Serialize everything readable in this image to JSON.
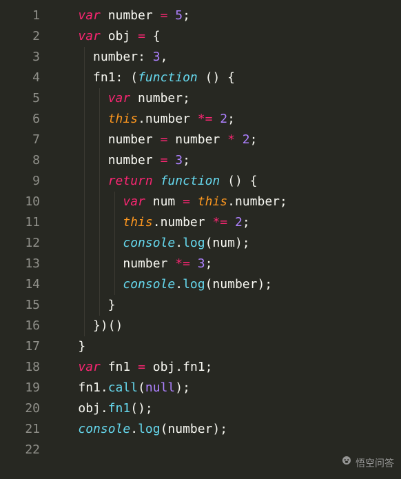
{
  "editor": {
    "line_count": 22,
    "line_numbers": [
      "1",
      "2",
      "3",
      "4",
      "5",
      "6",
      "7",
      "8",
      "9",
      "10",
      "11",
      "12",
      "13",
      "14",
      "15",
      "16",
      "17",
      "18",
      "19",
      "20",
      "21",
      "22"
    ],
    "indent_unit": "  ",
    "lines": [
      {
        "indent": 2,
        "tokens": [
          {
            "cls": "kw",
            "t": "var"
          },
          {
            "cls": "ident",
            "t": " number "
          },
          {
            "cls": "op",
            "t": "="
          },
          {
            "cls": "ident",
            "t": " "
          },
          {
            "cls": "num",
            "t": "5"
          },
          {
            "cls": "punc",
            "t": ";"
          }
        ]
      },
      {
        "indent": 2,
        "tokens": [
          {
            "cls": "kw",
            "t": "var"
          },
          {
            "cls": "ident",
            "t": " obj "
          },
          {
            "cls": "op",
            "t": "="
          },
          {
            "cls": "ident",
            "t": " "
          },
          {
            "cls": "punc",
            "t": "{"
          }
        ]
      },
      {
        "indent": 3,
        "tokens": [
          {
            "cls": "ident",
            "t": "number"
          },
          {
            "cls": "punc",
            "t": ": "
          },
          {
            "cls": "num",
            "t": "3"
          },
          {
            "cls": "punc",
            "t": ","
          }
        ]
      },
      {
        "indent": 3,
        "tokens": [
          {
            "cls": "ident",
            "t": "fn1"
          },
          {
            "cls": "punc",
            "t": ": ("
          },
          {
            "cls": "func",
            "t": "function"
          },
          {
            "cls": "punc",
            "t": " () {"
          }
        ]
      },
      {
        "indent": 4,
        "tokens": [
          {
            "cls": "kw",
            "t": "var"
          },
          {
            "cls": "ident",
            "t": " number"
          },
          {
            "cls": "punc",
            "t": ";"
          }
        ]
      },
      {
        "indent": 4,
        "tokens": [
          {
            "cls": "this",
            "t": "this"
          },
          {
            "cls": "punc",
            "t": "."
          },
          {
            "cls": "ident",
            "t": "number "
          },
          {
            "cls": "op",
            "t": "*="
          },
          {
            "cls": "ident",
            "t": " "
          },
          {
            "cls": "num",
            "t": "2"
          },
          {
            "cls": "punc",
            "t": ";"
          }
        ]
      },
      {
        "indent": 4,
        "tokens": [
          {
            "cls": "ident",
            "t": "number "
          },
          {
            "cls": "op",
            "t": "="
          },
          {
            "cls": "ident",
            "t": " number "
          },
          {
            "cls": "op",
            "t": "*"
          },
          {
            "cls": "ident",
            "t": " "
          },
          {
            "cls": "num",
            "t": "2"
          },
          {
            "cls": "punc",
            "t": ";"
          }
        ]
      },
      {
        "indent": 4,
        "tokens": [
          {
            "cls": "ident",
            "t": "number "
          },
          {
            "cls": "op",
            "t": "="
          },
          {
            "cls": "ident",
            "t": " "
          },
          {
            "cls": "num",
            "t": "3"
          },
          {
            "cls": "punc",
            "t": ";"
          }
        ]
      },
      {
        "indent": 4,
        "tokens": [
          {
            "cls": "kw",
            "t": "return"
          },
          {
            "cls": "ident",
            "t": " "
          },
          {
            "cls": "func",
            "t": "function"
          },
          {
            "cls": "punc",
            "t": " () {"
          }
        ]
      },
      {
        "indent": 5,
        "tokens": [
          {
            "cls": "kw",
            "t": "var"
          },
          {
            "cls": "ident",
            "t": " num "
          },
          {
            "cls": "op",
            "t": "="
          },
          {
            "cls": "ident",
            "t": " "
          },
          {
            "cls": "this",
            "t": "this"
          },
          {
            "cls": "punc",
            "t": "."
          },
          {
            "cls": "ident",
            "t": "number"
          },
          {
            "cls": "punc",
            "t": ";"
          }
        ]
      },
      {
        "indent": 5,
        "tokens": [
          {
            "cls": "this",
            "t": "this"
          },
          {
            "cls": "punc",
            "t": "."
          },
          {
            "cls": "ident",
            "t": "number "
          },
          {
            "cls": "op",
            "t": "*="
          },
          {
            "cls": "ident",
            "t": " "
          },
          {
            "cls": "num",
            "t": "2"
          },
          {
            "cls": "punc",
            "t": ";"
          }
        ]
      },
      {
        "indent": 5,
        "tokens": [
          {
            "cls": "console",
            "t": "console"
          },
          {
            "cls": "punc",
            "t": "."
          },
          {
            "cls": "method",
            "t": "log"
          },
          {
            "cls": "punc",
            "t": "(num);"
          }
        ]
      },
      {
        "indent": 5,
        "tokens": [
          {
            "cls": "ident",
            "t": "number "
          },
          {
            "cls": "op",
            "t": "*="
          },
          {
            "cls": "ident",
            "t": " "
          },
          {
            "cls": "num",
            "t": "3"
          },
          {
            "cls": "punc",
            "t": ";"
          }
        ]
      },
      {
        "indent": 5,
        "tokens": [
          {
            "cls": "console",
            "t": "console"
          },
          {
            "cls": "punc",
            "t": "."
          },
          {
            "cls": "method",
            "t": "log"
          },
          {
            "cls": "punc",
            "t": "(number);"
          }
        ]
      },
      {
        "indent": 4,
        "tokens": [
          {
            "cls": "punc",
            "t": "}"
          }
        ]
      },
      {
        "indent": 3,
        "tokens": [
          {
            "cls": "punc",
            "t": "})()"
          }
        ]
      },
      {
        "indent": 2,
        "tokens": [
          {
            "cls": "punc",
            "t": "}"
          }
        ]
      },
      {
        "indent": 2,
        "tokens": [
          {
            "cls": "kw",
            "t": "var"
          },
          {
            "cls": "ident",
            "t": " fn1 "
          },
          {
            "cls": "op",
            "t": "="
          },
          {
            "cls": "ident",
            "t": " obj"
          },
          {
            "cls": "punc",
            "t": "."
          },
          {
            "cls": "ident",
            "t": "fn1"
          },
          {
            "cls": "punc",
            "t": ";"
          }
        ]
      },
      {
        "indent": 2,
        "tokens": [
          {
            "cls": "ident",
            "t": "fn1"
          },
          {
            "cls": "punc",
            "t": "."
          },
          {
            "cls": "method",
            "t": "call"
          },
          {
            "cls": "punc",
            "t": "("
          },
          {
            "cls": "null",
            "t": "null"
          },
          {
            "cls": "punc",
            "t": ");"
          }
        ]
      },
      {
        "indent": 2,
        "tokens": [
          {
            "cls": "ident",
            "t": "obj"
          },
          {
            "cls": "punc",
            "t": "."
          },
          {
            "cls": "method",
            "t": "fn1"
          },
          {
            "cls": "punc",
            "t": "();"
          }
        ]
      },
      {
        "indent": 2,
        "tokens": [
          {
            "cls": "console",
            "t": "console"
          },
          {
            "cls": "punc",
            "t": "."
          },
          {
            "cls": "method",
            "t": "log"
          },
          {
            "cls": "punc",
            "t": "(number);"
          }
        ]
      },
      {
        "indent": 2,
        "tokens": []
      }
    ]
  },
  "watermark": {
    "text": "悟空问答",
    "icon": "monkey-icon"
  }
}
